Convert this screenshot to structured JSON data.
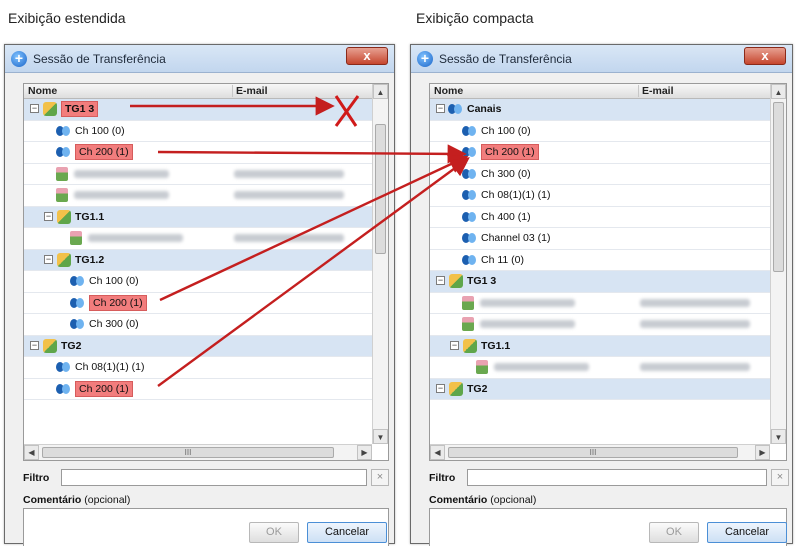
{
  "captions": {
    "left": "Exibição estendida",
    "right": "Exibição compacta"
  },
  "dialog": {
    "title": "Sessão de Transferência",
    "close_glyph": "x",
    "col_name": "Nome",
    "col_email": "E-mail",
    "filter_label": "Filtro",
    "filter_clear_glyph": "×",
    "comment_label": "Comentário",
    "comment_optional": "(opcional)",
    "ok_label": "OK",
    "cancel_label": "Cancelar",
    "hscroll_grip": "III"
  },
  "extended_rows": [
    {
      "kind": "group",
      "indent": 0,
      "label": "TG1 3",
      "highlight": true
    },
    {
      "kind": "channel",
      "indent": 1,
      "label": "Ch 100 (0)",
      "highlight": false
    },
    {
      "kind": "channel",
      "indent": 1,
      "label": "Ch 200 (1)",
      "highlight": true
    },
    {
      "kind": "user",
      "indent": 1
    },
    {
      "kind": "user",
      "indent": 1
    },
    {
      "kind": "group",
      "indent": 1,
      "label": "TG1.1",
      "highlight": false
    },
    {
      "kind": "user",
      "indent": 2
    },
    {
      "kind": "group",
      "indent": 1,
      "label": "TG1.2",
      "highlight": false
    },
    {
      "kind": "channel",
      "indent": 2,
      "label": "Ch 100 (0)",
      "highlight": false
    },
    {
      "kind": "channel",
      "indent": 2,
      "label": "Ch 200 (1)",
      "highlight": true
    },
    {
      "kind": "channel",
      "indent": 2,
      "label": "Ch 300 (0)",
      "highlight": false
    },
    {
      "kind": "group",
      "indent": 0,
      "label": "TG2",
      "highlight": false
    },
    {
      "kind": "channel",
      "indent": 1,
      "label": "Ch 08(1)(1) (1)",
      "highlight": false
    },
    {
      "kind": "channel",
      "indent": 1,
      "label": "Ch 200 (1)",
      "highlight": true
    }
  ],
  "compact_rows": [
    {
      "kind": "group-channels",
      "indent": 0,
      "label": "Canais",
      "highlight": false
    },
    {
      "kind": "channel",
      "indent": 1,
      "label": "Ch 100 (0)",
      "highlight": false
    },
    {
      "kind": "channel",
      "indent": 1,
      "label": "Ch 200 (1)",
      "highlight": true
    },
    {
      "kind": "channel",
      "indent": 1,
      "label": "Ch 300 (0)",
      "highlight": false
    },
    {
      "kind": "channel",
      "indent": 1,
      "label": "Ch 08(1)(1) (1)",
      "highlight": false
    },
    {
      "kind": "channel",
      "indent": 1,
      "label": "Ch 400 (1)",
      "highlight": false
    },
    {
      "kind": "channel",
      "indent": 1,
      "label": "Channel 03 (1)",
      "highlight": false
    },
    {
      "kind": "channel",
      "indent": 1,
      "label": "Ch 11 (0)",
      "highlight": false
    },
    {
      "kind": "group",
      "indent": 0,
      "label": "TG1 3",
      "highlight": false
    },
    {
      "kind": "user",
      "indent": 1
    },
    {
      "kind": "user",
      "indent": 1
    },
    {
      "kind": "group",
      "indent": 1,
      "label": "TG1.1",
      "highlight": false
    },
    {
      "kind": "user",
      "indent": 2
    },
    {
      "kind": "group",
      "indent": 0,
      "label": "TG2",
      "highlight": false
    }
  ],
  "colors": {
    "highlight": "#f27d7d",
    "arrow": "#c41f1f",
    "group_row": "#d7e4f3"
  }
}
